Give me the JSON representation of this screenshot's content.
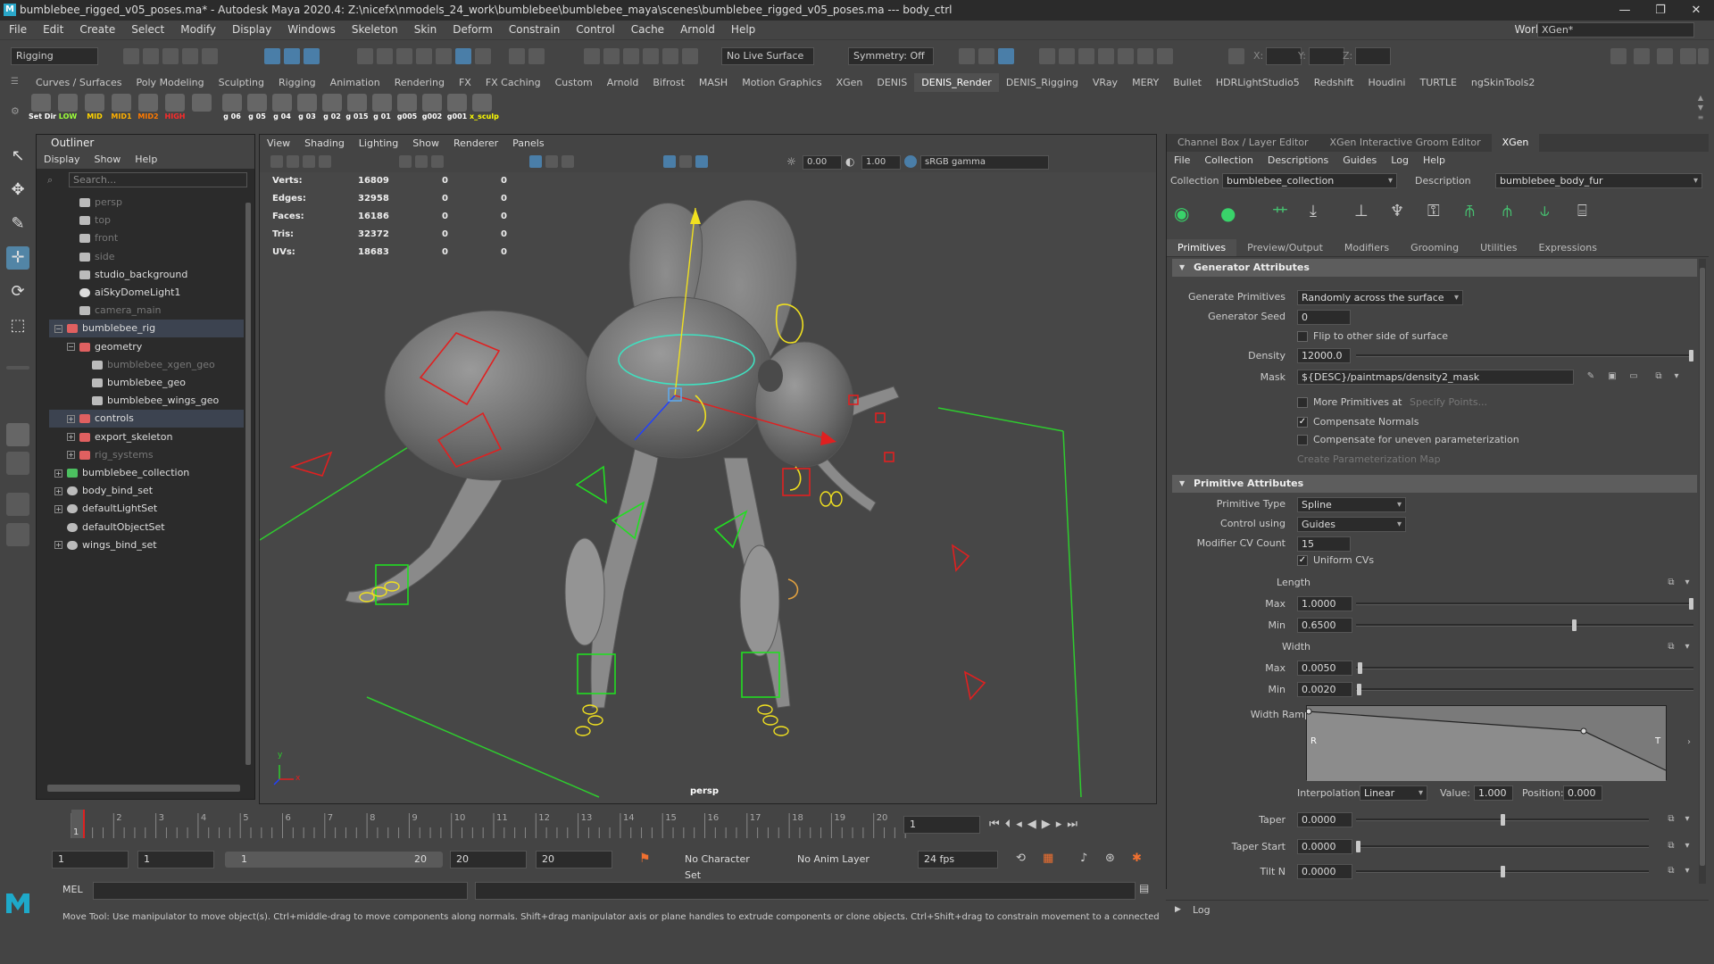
{
  "window": {
    "title": "bumblebee_rigged_v05_poses.ma* - Autodesk Maya 2020.4: Z:\\nicefx\\nmodels_24_work\\bumblebee\\bumblebee_maya\\scenes\\bumblebee_rigged_v05_poses.ma  ---  body_ctrl",
    "controls": [
      "—",
      "❐",
      "✕"
    ]
  },
  "menubar": {
    "items": [
      "File",
      "Edit",
      "Create",
      "Select",
      "Modify",
      "Display",
      "Windows",
      "Skeleton",
      "Skin",
      "Deform",
      "Constrain",
      "Control",
      "Cache",
      "Arnold",
      "Help"
    ],
    "workspace_label": "Workspace :",
    "workspace_value": "XGen*"
  },
  "statusline": {
    "menuset": "Rigging",
    "live_surface": "No Live Surface",
    "symmetry": "Symmetry: Off",
    "x_label": "X:",
    "y_label": "Y:",
    "z_label": "Z:"
  },
  "shelf": {
    "tabs": [
      "Curves / Surfaces",
      "Poly Modeling",
      "Sculpting",
      "Rigging",
      "Animation",
      "Rendering",
      "FX",
      "FX Caching",
      "Custom",
      "Arnold",
      "Bifrost",
      "MASH",
      "Motion Graphics",
      "XGen",
      "DENIS",
      "DENIS_Render",
      "DENIS_Rigging",
      "VRay",
      "MERY",
      "Bullet",
      "HDRLightStudio5",
      "Redshift",
      "Houdini",
      "TURTLE",
      "ngSkinTools2"
    ],
    "active_tab": "DENIS_Render",
    "buttons": [
      {
        "label": "Set Dir",
        "color": "#ffffff"
      },
      {
        "label": "LOW",
        "color": "#9cff3a"
      },
      {
        "label": "MID",
        "color": "#ffd400"
      },
      {
        "label": "MID1",
        "color": "#ffb000"
      },
      {
        "label": "MID2",
        "color": "#ff7a00"
      },
      {
        "label": "HIGH",
        "color": "#ff2a2a"
      },
      {
        "label": "",
        "color": "#ffffff"
      },
      {
        "label": "g 06",
        "color": "#ffffff"
      },
      {
        "label": "g 05",
        "color": "#ffffff"
      },
      {
        "label": "g 04",
        "color": "#ffffff"
      },
      {
        "label": "g 03",
        "color": "#ffffff"
      },
      {
        "label": "g 02",
        "color": "#ffffff"
      },
      {
        "label": "g 015",
        "color": "#ffffff"
      },
      {
        "label": "g 01",
        "color": "#ffffff"
      },
      {
        "label": "g005",
        "color": "#ffffff"
      },
      {
        "label": "g002",
        "color": "#ffffff"
      },
      {
        "label": "g001",
        "color": "#ffffff"
      },
      {
        "label": "x_sculp",
        "color": "#ffff00"
      }
    ]
  },
  "outliner": {
    "title": "Outliner",
    "menus": [
      "Display",
      "Show",
      "Help"
    ],
    "search_placeholder": "Search...",
    "rows": [
      {
        "label": "persp",
        "dim": true,
        "indent": 1,
        "icon": "camera-icon",
        "exp": ""
      },
      {
        "label": "top",
        "dim": true,
        "indent": 1,
        "icon": "camera-icon",
        "exp": ""
      },
      {
        "label": "front",
        "dim": true,
        "indent": 1,
        "icon": "camera-icon",
        "exp": ""
      },
      {
        "label": "side",
        "dim": true,
        "indent": 1,
        "icon": "camera-icon",
        "exp": ""
      },
      {
        "label": "studio_background",
        "dim": false,
        "indent": 1,
        "icon": "mesh-icon",
        "exp": ""
      },
      {
        "label": "aiSkyDomeLight1",
        "dim": false,
        "indent": 1,
        "icon": "light-icon",
        "exp": ""
      },
      {
        "label": "camera_main",
        "dim": true,
        "indent": 1,
        "icon": "camera-icon",
        "exp": ""
      },
      {
        "label": "bumblebee_rig",
        "dim": false,
        "indent": 0,
        "icon": "group-icon",
        "exp": "−",
        "selected": true
      },
      {
        "label": "geometry",
        "dim": false,
        "indent": 1,
        "icon": "group-icon",
        "exp": "−"
      },
      {
        "label": "bumblebee_xgen_geo",
        "dim": true,
        "indent": 2,
        "icon": "mesh-icon",
        "exp": ""
      },
      {
        "label": "bumblebee_geo",
        "dim": false,
        "indent": 2,
        "icon": "mesh-icon",
        "exp": ""
      },
      {
        "label": "bumblebee_wings_geo",
        "dim": false,
        "indent": 2,
        "icon": "mesh-icon",
        "exp": ""
      },
      {
        "label": "controls",
        "dim": false,
        "indent": 1,
        "icon": "group-icon",
        "exp": "+",
        "selected": true
      },
      {
        "label": "export_skeleton",
        "dim": false,
        "indent": 1,
        "icon": "group-icon",
        "exp": "+"
      },
      {
        "label": "rig_systems",
        "dim": true,
        "indent": 1,
        "icon": "group-icon",
        "exp": "+"
      },
      {
        "label": "bumblebee_collection",
        "dim": false,
        "indent": 0,
        "icon": "xgen-icon",
        "exp": "+"
      },
      {
        "label": "body_bind_set",
        "dim": false,
        "indent": 0,
        "icon": "set-icon",
        "exp": "+"
      },
      {
        "label": "defaultLightSet",
        "dim": false,
        "indent": 0,
        "icon": "set-icon",
        "exp": "+"
      },
      {
        "label": "defaultObjectSet",
        "dim": false,
        "indent": 0,
        "icon": "set-icon",
        "exp": ""
      },
      {
        "label": "wings_bind_set",
        "dim": false,
        "indent": 0,
        "icon": "set-icon",
        "exp": "+"
      }
    ]
  },
  "viewport": {
    "menus": [
      "View",
      "Shading",
      "Lighting",
      "Show",
      "Renderer",
      "Panels"
    ],
    "exposure": "0.00",
    "gamma": "1.00",
    "colorspace": "sRGB gamma",
    "hud": [
      {
        "label": "Verts:",
        "a": "16809",
        "b": "0",
        "c": "0"
      },
      {
        "label": "Edges:",
        "a": "32958",
        "b": "0",
        "c": "0"
      },
      {
        "label": "Faces:",
        "a": "16186",
        "b": "0",
        "c": "0"
      },
      {
        "label": "Tris:",
        "a": "32372",
        "b": "0",
        "c": "0"
      },
      {
        "label": "UVs:",
        "a": "18683",
        "b": "0",
        "c": "0"
      }
    ],
    "camera_label": "persp",
    "axis_y": "y",
    "axis_x": "x"
  },
  "rightpanel": {
    "tabs": [
      "Channel Box / Layer Editor",
      "XGen Interactive Groom Editor",
      "XGen"
    ],
    "active_tab": "XGen",
    "menus": [
      "File",
      "Collection",
      "Descriptions",
      "Guides",
      "Log",
      "Help"
    ],
    "collection_label": "Collection",
    "collection_value": "bumblebee_collection",
    "description_label": "Description",
    "description_value": "bumblebee_body_fur",
    "subtabs": [
      "Primitives",
      "Preview/Output",
      "Modifiers",
      "Grooming",
      "Utilities",
      "Expressions"
    ],
    "active_subtab": "Primitives",
    "generator": {
      "header": "Generator Attributes",
      "gen_prims_label": "Generate Primitives",
      "gen_prims_value": "Randomly across the surface",
      "seed_label": "Generator Seed",
      "seed_value": "0",
      "flip_label": "Flip to other side of surface",
      "density_label": "Density",
      "density_value": "12000.0",
      "density_level": 1.0,
      "mask_label": "Mask",
      "mask_value": "${DESC}/paintmaps/density2_mask",
      "more_prims_label": "More Primitives at",
      "specify_points": "Specify Points...",
      "comp_normals_label": "Compensate Normals",
      "comp_uneven_label": "Compensate for uneven parameterization",
      "create_param_map": "Create Parameterization Map"
    },
    "primitive": {
      "header": "Primitive Attributes",
      "type_label": "Primitive Type",
      "type_value": "Spline",
      "control_label": "Control using",
      "control_value": "Guides",
      "cv_label": "Modifier CV Count",
      "cv_value": "15",
      "uniform_label": "Uniform CVs",
      "length_label": "Length",
      "max_label": "Max",
      "length_max": "1.0000",
      "length_max_level": 1.0,
      "min_label": "Min",
      "length_min": "0.6500",
      "length_min_level": 0.65,
      "width_label": "Width",
      "width_max": "0.0050",
      "width_max_level": 0.005,
      "width_min": "0.0020",
      "width_min_level": 0.002,
      "ramp_label": "Width Ramp",
      "ramp_r": "R",
      "ramp_t": "T",
      "interp_label": "Interpolation:",
      "interp_value": "Linear",
      "value_label": "Value:",
      "value_value": "1.000",
      "position_label": "Position:",
      "position_value": "0.000",
      "taper_label": "Taper",
      "taper_value": "0.0000",
      "taper_level": 0.5,
      "taper_start_label": "Taper Start",
      "taper_start_value": "0.0000",
      "taper_start_level": 0.0,
      "tilt_label": "Tilt N",
      "tilt_value": "0.0000",
      "tilt_level": 0.5
    },
    "log_label": "Log"
  },
  "timeline": {
    "ticks": [
      "1",
      "2",
      "3",
      "4",
      "5",
      "6",
      "7",
      "8",
      "9",
      "10",
      "11",
      "12",
      "13",
      "14",
      "15",
      "16",
      "17",
      "18",
      "19",
      "20"
    ],
    "current_frame": "1",
    "frame_field": "1",
    "range_start": "1",
    "range_inner_start": "1",
    "range_slider_start": "1",
    "range_slider_end": "20",
    "range_inner_end": "20",
    "range_end": "20",
    "character_set": "No Character Set",
    "anim_layer": "No Anim Layer",
    "fps": "24 fps"
  },
  "commandline": {
    "label": "MEL"
  },
  "helpline": {
    "text": "Move Tool: Use manipulator to move object(s). Ctrl+middle-drag to move components along normals. Shift+drag manipulator axis or plane handles to extrude components or clone objects. Ctrl+Shift+drag to constrain movement to a connected edge. Use D or INSERT to change"
  },
  "colors": {
    "accent": "#5285a6",
    "rig_red": "#e02020",
    "rig_green": "#22dd22",
    "rig_yellow": "#f0e020",
    "rig_cyan": "#40e0c0"
  }
}
